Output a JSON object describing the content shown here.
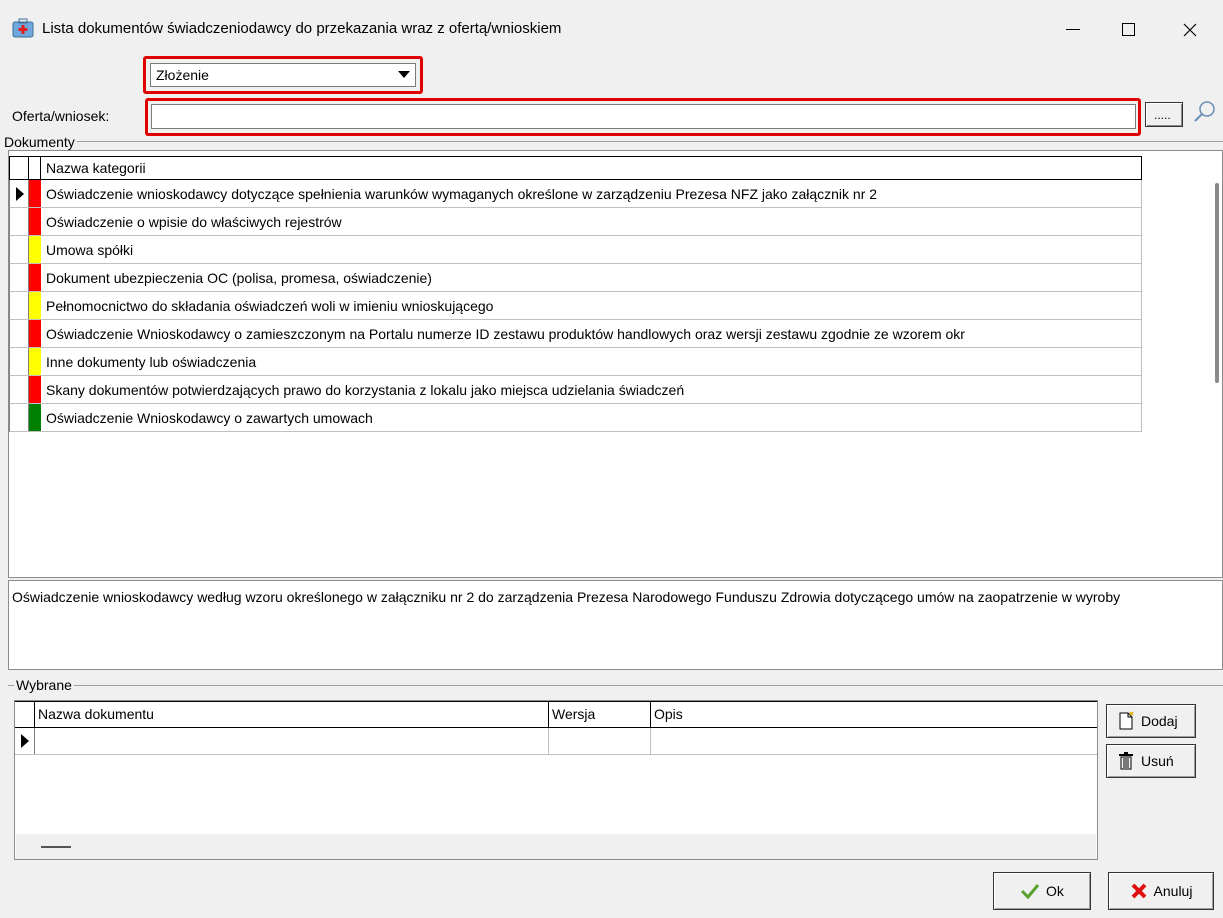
{
  "window": {
    "title": "Lista dokumentów świadczeniodawcy do przekazania wraz z ofertą/wnioskiem",
    "minimize": "—",
    "maximize": "☐",
    "close": "✕"
  },
  "filter": {
    "combo_value": "Złożenie",
    "oferta_label": "Oferta/wniosek:",
    "oferta_value": "",
    "dots_label": "....."
  },
  "dokumenty": {
    "group_label": "Dokumenty",
    "column_header": "Nazwa kategorii",
    "selected_row_index": 0,
    "rows": [
      {
        "name": "Oświadczenie wnioskodawcy dotyczące spełnienia warunków wymaganych określone w zarządzeniu Prezesa NFZ jako załącznik nr 2",
        "status_color": "#ff0000"
      },
      {
        "name": "Oświadczenie o wpisie do właściwych rejestrów",
        "status_color": "#ff0000"
      },
      {
        "name": "Umowa spółki",
        "status_color": "#ffff00"
      },
      {
        "name": "Dokument ubezpieczenia OC (polisa, promesa, oświadczenie)",
        "status_color": "#ff0000"
      },
      {
        "name": "Pełnomocnictwo do składania oświadczeń woli w imieniu wnioskującego",
        "status_color": "#ffff00"
      },
      {
        "name": "Oświadczenie Wnioskodawcy o zamieszczonym na Portalu numerze ID zestawu produktów handlowych oraz wersji zestawu zgodnie ze wzorem okr",
        "status_color": "#ff0000"
      },
      {
        "name": "Inne dokumenty lub oświadczenia",
        "status_color": "#ffff00"
      },
      {
        "name": "Skany dokumentów potwierdzających prawo do korzystania z lokalu jako miejsca udzielania świadczeń",
        "status_color": "#ff0000"
      },
      {
        "name": "Oświadczenie Wnioskodawcy o zawartych umowach",
        "status_color": "#008000"
      }
    ]
  },
  "description": {
    "text": "Oświadczenie wnioskodawcy według wzoru określonego w załączniku nr 2 do zarządzenia Prezesa Narodowego Funduszu Zdrowia dotyczącego umów na zaopatrzenie w wyroby"
  },
  "wybrane": {
    "group_label": "Wybrane",
    "columns": [
      "Nazwa dokumentu",
      "Wersja",
      "Opis"
    ]
  },
  "buttons": {
    "dodaj": "Dodaj",
    "usun": "Usuń",
    "ok": "Ok",
    "anuluj": "Anuluj"
  }
}
